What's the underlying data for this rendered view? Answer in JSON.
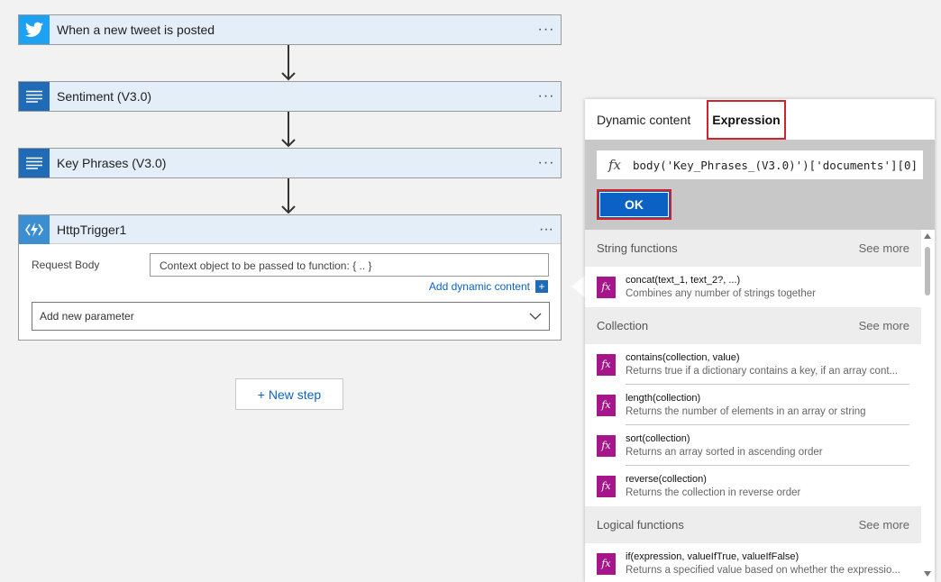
{
  "flow": {
    "steps": [
      {
        "label": "When a new tweet is posted",
        "icon": "twitter-icon"
      },
      {
        "label": "Sentiment (V3.0)",
        "icon": "text-analytics-icon"
      },
      {
        "label": "Key Phrases (V3.0)",
        "icon": "text-analytics-icon"
      }
    ],
    "more_glyph": "···",
    "http_trigger": {
      "title": "HttpTrigger1",
      "request_body_label": "Request Body",
      "request_body_placeholder": "Context object to be passed to function: { .. }",
      "add_dynamic_content": "Add dynamic content",
      "add_new_parameter": "Add new parameter"
    },
    "new_step": "+ New step"
  },
  "panel": {
    "tabs": {
      "dynamic": "Dynamic content",
      "expression": "Expression"
    },
    "expression_value": "body('Key_Phrases_(V3.0)')['documents'][0]",
    "fx_glyph": "fx",
    "ok_label": "OK",
    "sections": [
      {
        "title": "String functions",
        "see_more": "See more",
        "items": [
          {
            "sig": "concat(text_1, text_2?, ...)",
            "desc": "Combines any number of strings together"
          }
        ]
      },
      {
        "title": "Collection",
        "see_more": "See more",
        "items": [
          {
            "sig": "contains(collection, value)",
            "desc": "Returns true if a dictionary contains a key, if an array cont..."
          },
          {
            "sig": "length(collection)",
            "desc": "Returns the number of elements in an array or string"
          },
          {
            "sig": "sort(collection)",
            "desc": "Returns an array sorted in ascending order"
          },
          {
            "sig": "reverse(collection)",
            "desc": "Returns the collection in reverse order"
          }
        ]
      },
      {
        "title": "Logical functions",
        "see_more": "See more",
        "items": [
          {
            "sig": "if(expression, valueIfTrue, valueIfFalse)",
            "desc": "Returns a specified value based on whether the expressio..."
          }
        ]
      }
    ]
  },
  "colors": {
    "accent_blue": "#0b62c4",
    "highlight_red": "#d0232d",
    "function_purple": "#a4168a",
    "twitter_blue": "#1da1f2"
  }
}
